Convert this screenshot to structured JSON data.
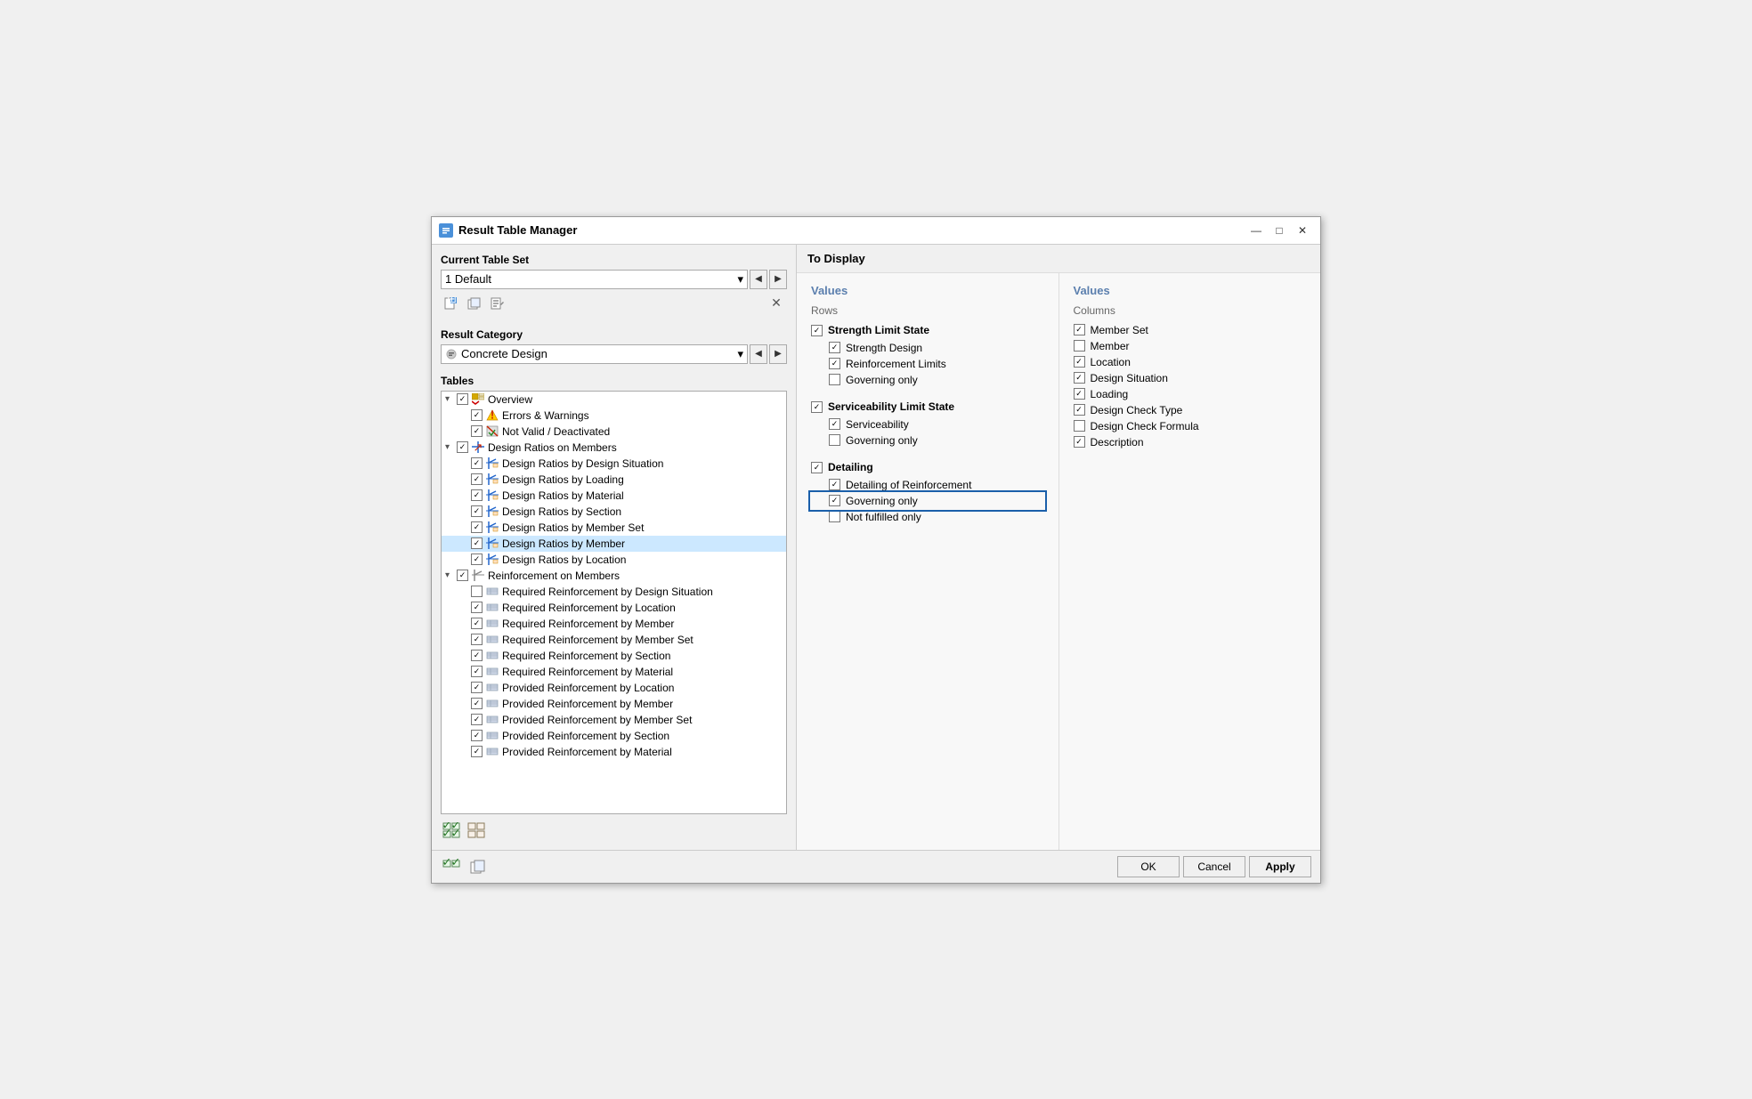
{
  "window": {
    "title": "Result Table Manager",
    "min_btn": "—",
    "max_btn": "□",
    "close_btn": "✕"
  },
  "left": {
    "current_table_set_label": "Current Table Set",
    "table_set_value": "1  Default",
    "toolbar_buttons": [
      "new",
      "copy",
      "edit",
      "delete"
    ],
    "result_category_label": "Result Category",
    "result_category_value": "Concrete Design",
    "tables_label": "Tables",
    "tree": [
      {
        "level": 0,
        "checked": true,
        "expanded": true,
        "icon": "overview",
        "text": "Overview",
        "selected": false
      },
      {
        "level": 1,
        "checked": true,
        "expanded": false,
        "icon": "warning",
        "text": "Errors & Warnings",
        "selected": false
      },
      {
        "level": 1,
        "checked": true,
        "expanded": false,
        "icon": "notvalid",
        "text": "Not Valid / Deactivated",
        "selected": false
      },
      {
        "level": 0,
        "checked": true,
        "expanded": true,
        "icon": "design",
        "text": "Design Ratios on Members",
        "selected": false
      },
      {
        "level": 1,
        "checked": true,
        "expanded": false,
        "icon": "ratio",
        "text": "Design Ratios by Design Situation",
        "selected": false
      },
      {
        "level": 1,
        "checked": true,
        "expanded": false,
        "icon": "ratio",
        "text": "Design Ratios by Loading",
        "selected": false
      },
      {
        "level": 1,
        "checked": true,
        "expanded": false,
        "icon": "ratio",
        "text": "Design Ratios by Material",
        "selected": false
      },
      {
        "level": 1,
        "checked": true,
        "expanded": false,
        "icon": "ratio",
        "text": "Design Ratios by Section",
        "selected": false
      },
      {
        "level": 1,
        "checked": true,
        "expanded": false,
        "icon": "ratio",
        "text": "Design Ratios by Member Set",
        "selected": false
      },
      {
        "level": 1,
        "checked": true,
        "expanded": false,
        "icon": "ratio",
        "text": "Design Ratios by Member",
        "selected": true
      },
      {
        "level": 1,
        "checked": true,
        "expanded": false,
        "icon": "ratio",
        "text": "Design Ratios by Location",
        "selected": false
      },
      {
        "level": 0,
        "checked": true,
        "expanded": true,
        "icon": "rein",
        "text": "Reinforcement on Members",
        "selected": false
      },
      {
        "level": 1,
        "checked": false,
        "expanded": false,
        "icon": "reinitem",
        "text": "Required Reinforcement by Design Situation",
        "selected": false
      },
      {
        "level": 1,
        "checked": true,
        "expanded": false,
        "icon": "reinitem",
        "text": "Required Reinforcement by Location",
        "selected": false
      },
      {
        "level": 1,
        "checked": true,
        "expanded": false,
        "icon": "reinitem",
        "text": "Required Reinforcement by Member",
        "selected": false
      },
      {
        "level": 1,
        "checked": true,
        "expanded": false,
        "icon": "reinitem",
        "text": "Required Reinforcement by Member Set",
        "selected": false
      },
      {
        "level": 1,
        "checked": true,
        "expanded": false,
        "icon": "reinitem",
        "text": "Required Reinforcement by Section",
        "selected": false
      },
      {
        "level": 1,
        "checked": true,
        "expanded": false,
        "icon": "reinitem",
        "text": "Required Reinforcement by Material",
        "selected": false
      },
      {
        "level": 1,
        "checked": true,
        "expanded": false,
        "icon": "reinitem",
        "text": "Provided Reinforcement by Location",
        "selected": false
      },
      {
        "level": 1,
        "checked": true,
        "expanded": false,
        "icon": "reinitem",
        "text": "Provided Reinforcement by Member",
        "selected": false
      },
      {
        "level": 1,
        "checked": true,
        "expanded": false,
        "icon": "reinitem",
        "text": "Provided Reinforcement by Member Set",
        "selected": false
      },
      {
        "level": 1,
        "checked": true,
        "expanded": false,
        "icon": "reinitem",
        "text": "Provided Reinforcement by Section",
        "selected": false
      },
      {
        "level": 1,
        "checked": true,
        "expanded": false,
        "icon": "reinitem",
        "text": "Provided Reinforcement by Material",
        "selected": false
      }
    ],
    "bottom_btns": [
      "check-all",
      "uncheck-all"
    ]
  },
  "right": {
    "to_display_label": "To Display",
    "left_panel": {
      "values_label": "Values",
      "rows_label": "Rows",
      "sections": [
        {
          "title": "Strength Limit State",
          "title_checked": true,
          "items": [
            {
              "text": "Strength Design",
              "checked": true,
              "focused": false
            },
            {
              "text": "Reinforcement Limits",
              "checked": true,
              "focused": false
            },
            {
              "text": "Governing only",
              "checked": false,
              "focused": false
            }
          ]
        },
        {
          "title": "Serviceability Limit State",
          "title_checked": true,
          "items": [
            {
              "text": "Serviceability",
              "checked": true,
              "focused": false
            },
            {
              "text": "Governing only",
              "checked": false,
              "focused": false
            }
          ]
        },
        {
          "title": "Detailing",
          "title_checked": true,
          "items": [
            {
              "text": "Detailing of Reinforcement",
              "checked": true,
              "focused": false
            },
            {
              "text": "Governing only",
              "checked": true,
              "focused": true
            },
            {
              "text": "Not fulfilled only",
              "checked": false,
              "focused": false
            }
          ]
        }
      ]
    },
    "right_panel": {
      "values_label": "Values",
      "columns_label": "Columns",
      "items": [
        {
          "text": "Member Set",
          "checked": true
        },
        {
          "text": "Member",
          "checked": false
        },
        {
          "text": "Location",
          "checked": true
        },
        {
          "text": "Design Situation",
          "checked": true
        },
        {
          "text": "Loading",
          "checked": true
        },
        {
          "text": "Design Check Type",
          "checked": true
        },
        {
          "text": "Design Check Formula",
          "checked": false
        },
        {
          "text": "Description",
          "checked": true
        }
      ]
    }
  },
  "footer": {
    "ok_label": "OK",
    "cancel_label": "Cancel",
    "apply_label": "Apply"
  }
}
